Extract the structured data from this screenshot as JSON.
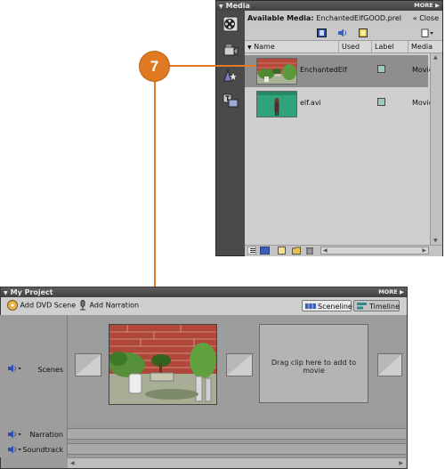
{
  "callout": {
    "number": "7"
  },
  "media_panel": {
    "title": "Media",
    "more": "MORE",
    "available_label": "Available Media:",
    "available_file": "EnchantedElfGOOD.prel",
    "close": "Close",
    "columns": [
      "Name",
      "Used",
      "Label",
      "Media"
    ],
    "rows": [
      {
        "name": "EnchantedElf",
        "media": "Movie",
        "label_color": "#9ec9c0"
      },
      {
        "name": "elf.avi",
        "media": "Movie",
        "label_color": "#9ec9c0"
      }
    ]
  },
  "project_panel": {
    "title": "My Project",
    "more": "MORE",
    "add_dvd_scene": "Add DVD Scene",
    "add_narration": "Add Narration",
    "tab_sceneline": "Sceneline",
    "tab_timeline": "Timeline",
    "scenes_label": "Scenes",
    "narration_label": "Narration",
    "soundtrack_label": "Soundtrack",
    "drop_hint": "Drag clip here to add to movie"
  },
  "colors": {
    "accent": "#e07a22",
    "selected_row": "#8e8e8e"
  }
}
